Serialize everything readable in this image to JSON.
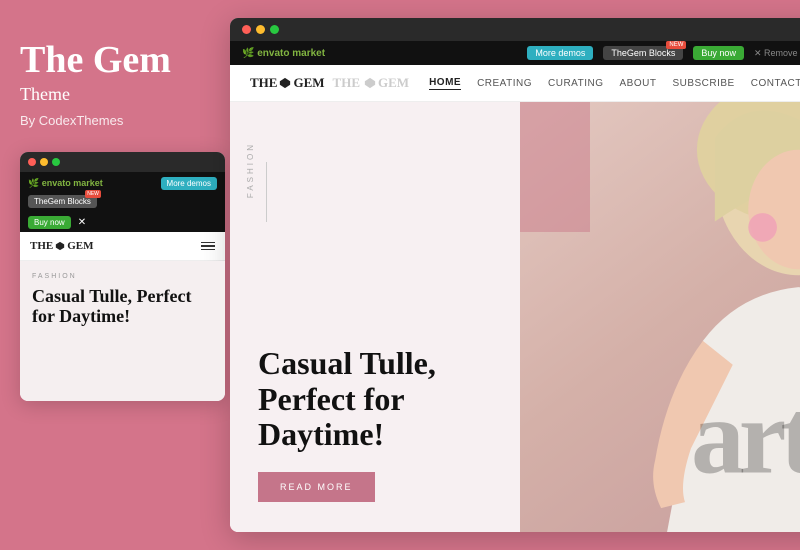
{
  "left": {
    "title": "The Gem",
    "subtitle": "Theme",
    "author": "By CodexThemes"
  },
  "mobile_preview": {
    "browser_dots": [
      "red",
      "yellow",
      "green"
    ],
    "topbar": {
      "envato_logo": "🌿 envato market",
      "buttons": [
        {
          "label": "More demos",
          "style": "teal"
        },
        {
          "label": "TheGem Blocks",
          "style": "dark",
          "badge": "NEW"
        },
        {
          "label": "Buy now",
          "style": "green"
        },
        {
          "label": "×",
          "style": "close"
        }
      ]
    },
    "nav": {
      "logo": "THE ♦ GEM",
      "hamburger": true
    },
    "hero": {
      "label": "FASHION",
      "title": "Casual Tulle, Perfect for Daytime!"
    }
  },
  "desktop_preview": {
    "browser_dots": [
      "red",
      "yellow",
      "green"
    ],
    "topbar": {
      "envato_logo": "🌿 envato market",
      "buttons": [
        {
          "label": "More demos",
          "style": "teal"
        },
        {
          "label": "TheGem Blocks",
          "style": "dark",
          "badge": "NEW"
        },
        {
          "label": "Buy now",
          "style": "green"
        },
        {
          "label": "× Remove Frame",
          "style": "close"
        }
      ]
    },
    "site_nav": {
      "logo": "THE ♦ GEM THE ♦ GEM",
      "links": [
        {
          "label": "HOME",
          "active": true
        },
        {
          "label": "CREATING",
          "active": false
        },
        {
          "label": "CURATING",
          "active": false
        },
        {
          "label": "ABOUT",
          "active": false
        },
        {
          "label": "SUBSCRIBE",
          "active": false
        },
        {
          "label": "CONTACT",
          "active": false
        }
      ]
    },
    "hero": {
      "fashion_label": "FASHION",
      "title": "Casual Tulle, Perfect for Daytime!",
      "read_more": "READ MORE"
    }
  }
}
